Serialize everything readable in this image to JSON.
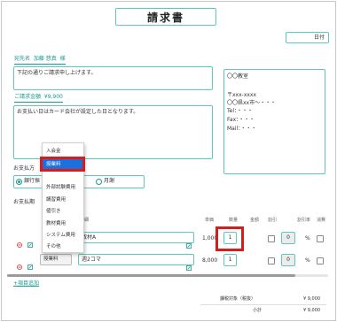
{
  "title": "請求書",
  "date_label": "日付",
  "recipient": {
    "label": "宛先名",
    "name": "加藤 悠真",
    "honorific": "様",
    "message": "下記の通りご請求申し上げます。"
  },
  "total": {
    "label": "ご請求金額",
    "amount": "¥9,900"
  },
  "note": "お支払い日はカード会社が設定した日となります。",
  "issuer": {
    "company": "〇〇教室",
    "postal": "〒xxx-xxxx",
    "address": "〇〇県xx市〜・・・",
    "tel": "Tel：・・・",
    "fax": "Fax：・・・",
    "mail": "Mail：・・・"
  },
  "payment": {
    "label": "お支払方",
    "options": [
      "銀行振",
      "月謝"
    ],
    "period_label": "お支払期"
  },
  "dropdown": {
    "items": [
      "入会金",
      "授業料",
      "外部試験費用",
      "講習費用",
      "値引き",
      "教材費用",
      "システム費用",
      "その他"
    ],
    "selected_index": 1
  },
  "table": {
    "headers": {
      "item": "項目",
      "detail": "詳細",
      "unit_price": "単価",
      "quantity": "数量",
      "amount": "金額",
      "discount": "割引",
      "discount_rate": "割引率",
      "tax": "消費"
    },
    "rows": [
      {
        "item": "",
        "detail": "教材A",
        "unit_price": "1,000",
        "quantity": "1",
        "discount_rate": "0",
        "percent": "%"
      },
      {
        "item": "授業料",
        "detail": "週2コマ",
        "unit_price": "8,000",
        "quantity": "1",
        "discount_rate": "0",
        "percent": "%"
      }
    ],
    "add_link": "+項目追加"
  },
  "summary": {
    "taxable_label": "課税対象（税抜）",
    "taxable_value": "¥ 9,000",
    "subtotal_label": "小計",
    "subtotal_value": "¥ 9,000"
  },
  "colors": {
    "accent": "#5ec8c0",
    "highlight": "#d81b1b",
    "selected": "#1e6fd9"
  }
}
